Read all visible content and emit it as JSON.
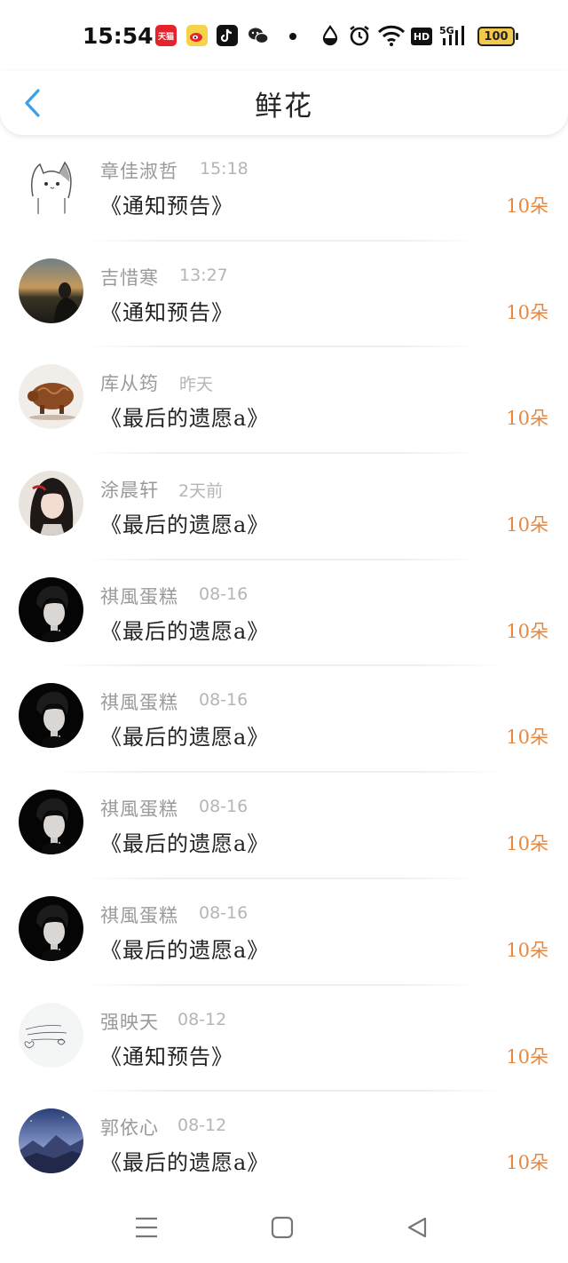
{
  "status_bar": {
    "time": "15:54",
    "apps": [
      {
        "name": "tmall-icon",
        "label": "天猫",
        "color": "#e6232d"
      },
      {
        "name": "weibo-icon",
        "label": "",
        "color": "#f7d34a"
      },
      {
        "name": "tiktok-icon",
        "label": "",
        "color": "#111111"
      },
      {
        "name": "wechat-icon",
        "label": "",
        "color": "#222222"
      }
    ],
    "hd": "HD",
    "network": "5G",
    "battery": "100"
  },
  "header": {
    "title": "鲜花"
  },
  "list": [
    {
      "name": "章佳淑哲",
      "time": "15:18",
      "book": "《通知预告》",
      "flowers": "10朵",
      "avatar": "cat"
    },
    {
      "name": "吉惜寒",
      "time": "13:27",
      "book": "《通知预告》",
      "flowers": "10朵",
      "avatar": "dusk"
    },
    {
      "name": "库从筠",
      "time": "昨天",
      "book": "《最后的遗愿a》",
      "flowers": "10朵",
      "avatar": "pig"
    },
    {
      "name": "涂晨轩",
      "time": "2天前",
      "book": "《最后的遗愿a》",
      "flowers": "10朵",
      "avatar": "anime"
    },
    {
      "name": "祺風蛋糕",
      "time": "08-16",
      "book": "《最后的遗愿a》",
      "flowers": "10朵",
      "avatar": "dark"
    },
    {
      "name": "祺風蛋糕",
      "time": "08-16",
      "book": "《最后的遗愿a》",
      "flowers": "10朵",
      "avatar": "dark"
    },
    {
      "name": "祺風蛋糕",
      "time": "08-16",
      "book": "《最后的遗愿a》",
      "flowers": "10朵",
      "avatar": "dark"
    },
    {
      "name": "祺風蛋糕",
      "time": "08-16",
      "book": "《最后的遗愿a》",
      "flowers": "10朵",
      "avatar": "dark"
    },
    {
      "name": "强映天",
      "time": "08-12",
      "book": "《通知预告》",
      "flowers": "10朵",
      "avatar": "sketch"
    },
    {
      "name": "郭依心",
      "time": "08-12",
      "book": "《最后的遗愿a》",
      "flowers": "10朵",
      "avatar": "mountain"
    }
  ],
  "colors": {
    "accent_blue": "#3a9ee8",
    "flower_orange": "#e8873c",
    "muted_text": "#9a9a9a"
  },
  "nav": {
    "menu": "menu-icon",
    "home": "home-icon",
    "back": "back-triangle-icon"
  }
}
